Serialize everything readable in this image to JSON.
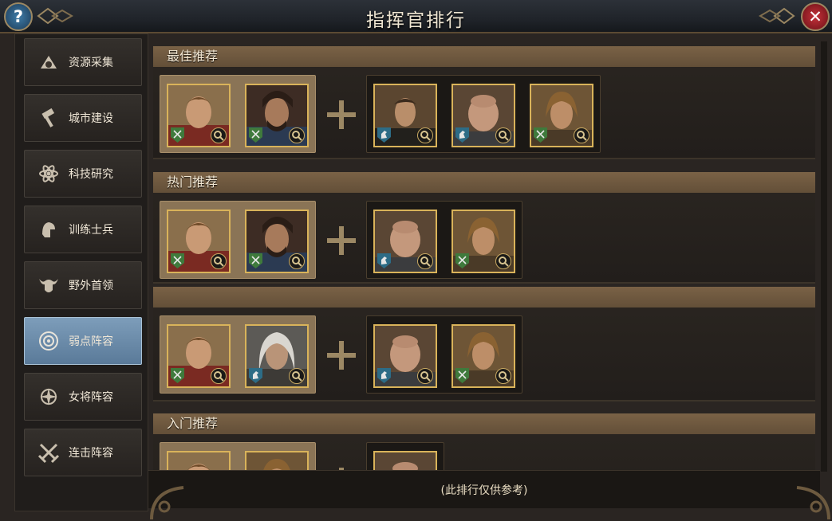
{
  "header": {
    "title": "指挥官排行",
    "help_label": "?",
    "close_label": "✕"
  },
  "sidebar": {
    "items": [
      {
        "label": "资源采集",
        "icon": "resource-gathering-icon",
        "active": false
      },
      {
        "label": "城市建设",
        "icon": "hammer-icon",
        "active": false
      },
      {
        "label": "科技研究",
        "icon": "atom-icon",
        "active": false
      },
      {
        "label": "训练士兵",
        "icon": "soldier-helmet-icon",
        "active": false
      },
      {
        "label": "野外首领",
        "icon": "horned-helmet-icon",
        "active": false
      },
      {
        "label": "弱点阵容",
        "icon": "target-icon",
        "active": true
      },
      {
        "label": "女将阵容",
        "icon": "compass-crest-icon",
        "active": false
      },
      {
        "label": "连击阵容",
        "icon": "crossed-swords-icon",
        "active": false
      }
    ]
  },
  "sections": [
    {
      "title": "最佳推荐"
    },
    {
      "title": "热门推荐"
    },
    {
      "title": ""
    },
    {
      "title": "入门推荐"
    }
  ],
  "footer": {
    "note": "(此排行仅供参考)"
  },
  "colors": {
    "accent_gold": "#d9b35a",
    "section_header": "#7a6246",
    "active_tab": "#7d9dba"
  }
}
